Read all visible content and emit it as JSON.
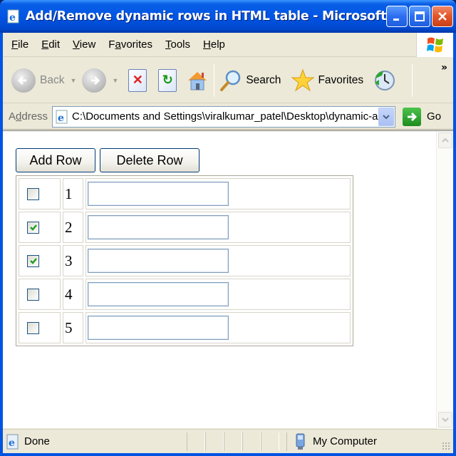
{
  "window": {
    "title": "Add/Remove dynamic rows in HTML table - Microsoft Inte...",
    "controls": {
      "minimize": "minimize",
      "maximize": "maximize",
      "close": "close"
    }
  },
  "menubar": {
    "items": [
      {
        "label": "File",
        "accel": "F"
      },
      {
        "label": "Edit",
        "accel": "E"
      },
      {
        "label": "View",
        "accel": "V"
      },
      {
        "label": "Favorites",
        "accel": "a"
      },
      {
        "label": "Tools",
        "accel": "T"
      },
      {
        "label": "Help",
        "accel": "H"
      }
    ]
  },
  "toolbar": {
    "back_label": "Back",
    "search_label": "Search",
    "favorites_label": "Favorites",
    "more": "»"
  },
  "addressbar": {
    "label": "Address",
    "url": "C:\\Documents and Settings\\viralkumar_patel\\Desktop\\dynamic-add",
    "go_label": "Go"
  },
  "page": {
    "add_row_label": "Add Row",
    "delete_row_label": "Delete Row",
    "rows": [
      {
        "checked": false,
        "number": "1",
        "text": ""
      },
      {
        "checked": true,
        "number": "2",
        "text": ""
      },
      {
        "checked": true,
        "number": "3",
        "text": ""
      },
      {
        "checked": false,
        "number": "4",
        "text": ""
      },
      {
        "checked": false,
        "number": "5",
        "text": ""
      }
    ]
  },
  "statusbar": {
    "status": "Done",
    "zone": "My Computer"
  },
  "colors": {
    "titlebar": "#0055e5",
    "chrome": "#ece9d8",
    "check_green": "#21a121",
    "close_red": "#e2552a"
  }
}
